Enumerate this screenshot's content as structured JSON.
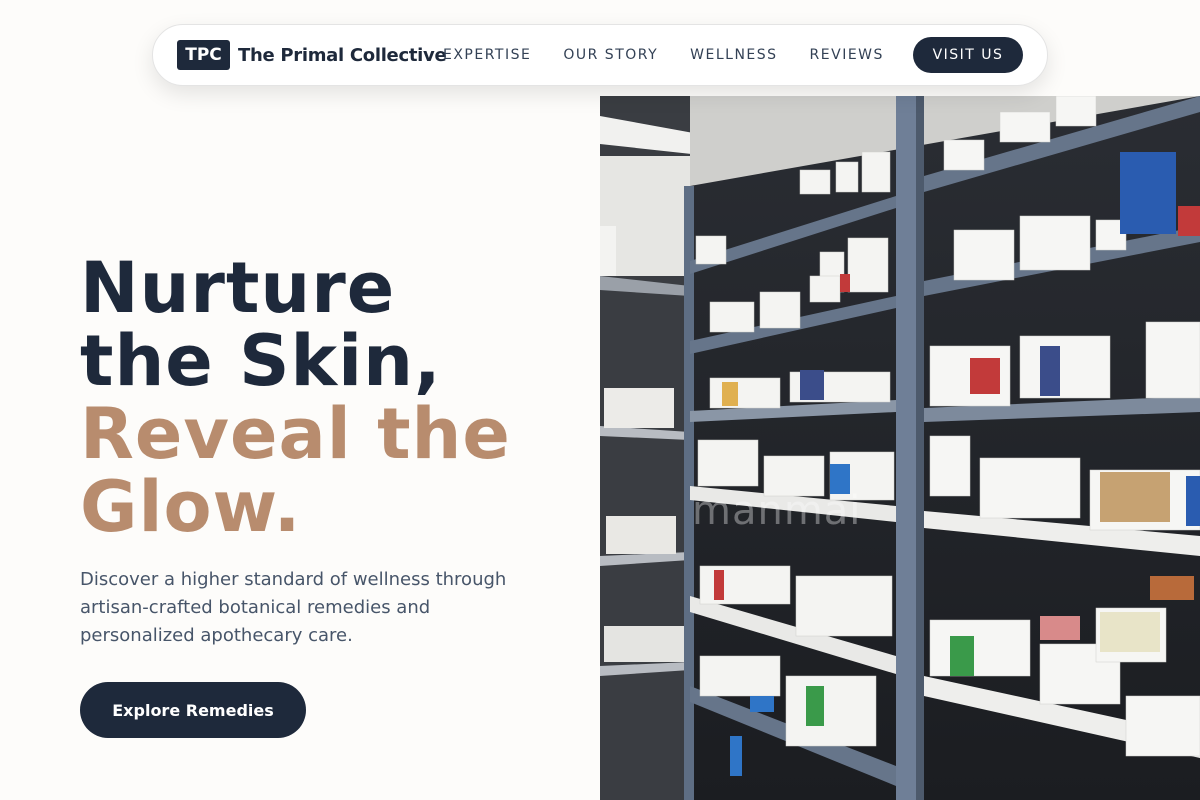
{
  "brand": {
    "logo_text": "TPC",
    "name": "The Primal Collective"
  },
  "nav": {
    "links": [
      "EXPERTISE",
      "OUR STORY",
      "WELLNESS",
      "REVIEWS"
    ],
    "cta": "VISIT US"
  },
  "hero": {
    "title_line1": "Nurture",
    "title_line2": "the Skin,",
    "title_line3": "Reveal the",
    "title_line4": "Glow.",
    "description": "Discover a higher standard of wellness through artisan-crafted botanical remedies and personalized apothecary care.",
    "cta": "Explore Remedies"
  },
  "image": {
    "watermark": "manmai"
  },
  "colors": {
    "navy": "#1e293b",
    "tan": "#b88c6e",
    "text_muted": "#475569",
    "background": "#fdfcfa"
  }
}
